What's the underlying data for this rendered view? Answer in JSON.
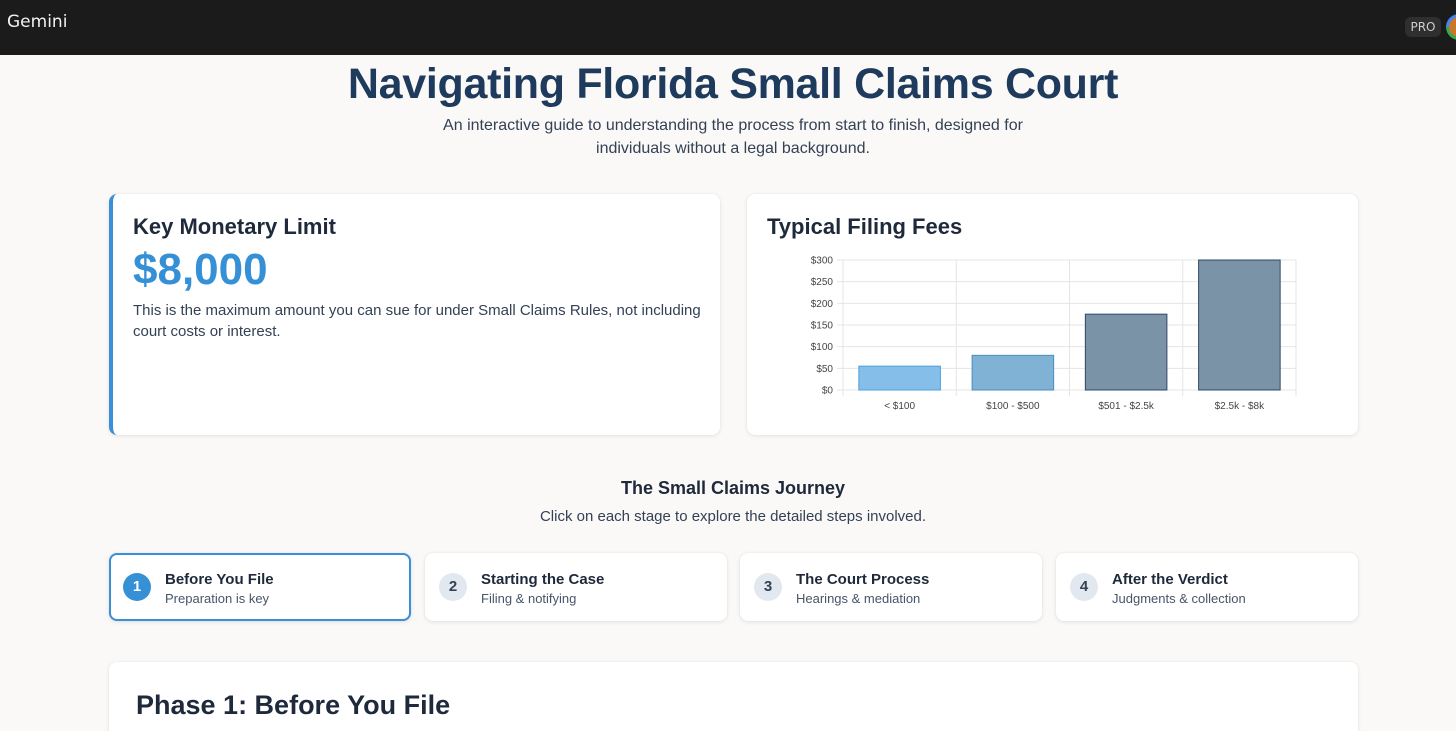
{
  "app": {
    "title": "Gemini",
    "badge": "PRO",
    "avatar_icon": "user-avatar"
  },
  "header": {
    "title": "Navigating Florida Small Claims Court",
    "subtitle": "An interactive guide to understanding the process from start to finish, designed for individuals without a legal background."
  },
  "limit_card": {
    "title": "Key Monetary Limit",
    "amount": "$8,000",
    "description": "This is the maximum amount you can sue for under Small Claims Rules, not including court costs or interest."
  },
  "fees_card": {
    "title": "Typical Filing Fees"
  },
  "chart_data": {
    "type": "bar",
    "title": "Typical Filing Fees",
    "categories": [
      "< $100",
      "$100 - $500",
      "$501 - $2.5k",
      "$2.5k - $8k"
    ],
    "values": [
      55,
      80,
      175,
      300
    ],
    "ylim": [
      0,
      300
    ],
    "yticks": [
      0,
      50,
      100,
      150,
      200,
      250,
      300
    ],
    "ytick_labels": [
      "$0",
      "$50",
      "$100",
      "$150",
      "$200",
      "$250",
      "$300"
    ],
    "grid": true,
    "legend": "none",
    "bar_fills": [
      "#85bfe9",
      "#80b2d6",
      "#7b93a7",
      "#7b93a7"
    ],
    "bar_strokes": [
      "#4a9fdc",
      "#4a8fc0",
      "#2d4a63",
      "#2d4a63"
    ]
  },
  "journey": {
    "title": "The Small Claims Journey",
    "subtitle": "Click on each stage to explore the detailed steps involved.",
    "stages": [
      {
        "number": "1",
        "title": "Before You File",
        "desc": "Preparation is key"
      },
      {
        "number": "2",
        "title": "Starting the Case",
        "desc": "Filing & notifying"
      },
      {
        "number": "3",
        "title": "The Court Process",
        "desc": "Hearings & mediation"
      },
      {
        "number": "4",
        "title": "After the Verdict",
        "desc": "Judgments & collection"
      }
    ]
  },
  "phase": {
    "title": "Phase 1: Before You File"
  },
  "colors": {
    "accent": "#3590d6",
    "heading": "#1e3a5c",
    "topbar": "#1b1b1b",
    "background": "#faf9f7"
  }
}
